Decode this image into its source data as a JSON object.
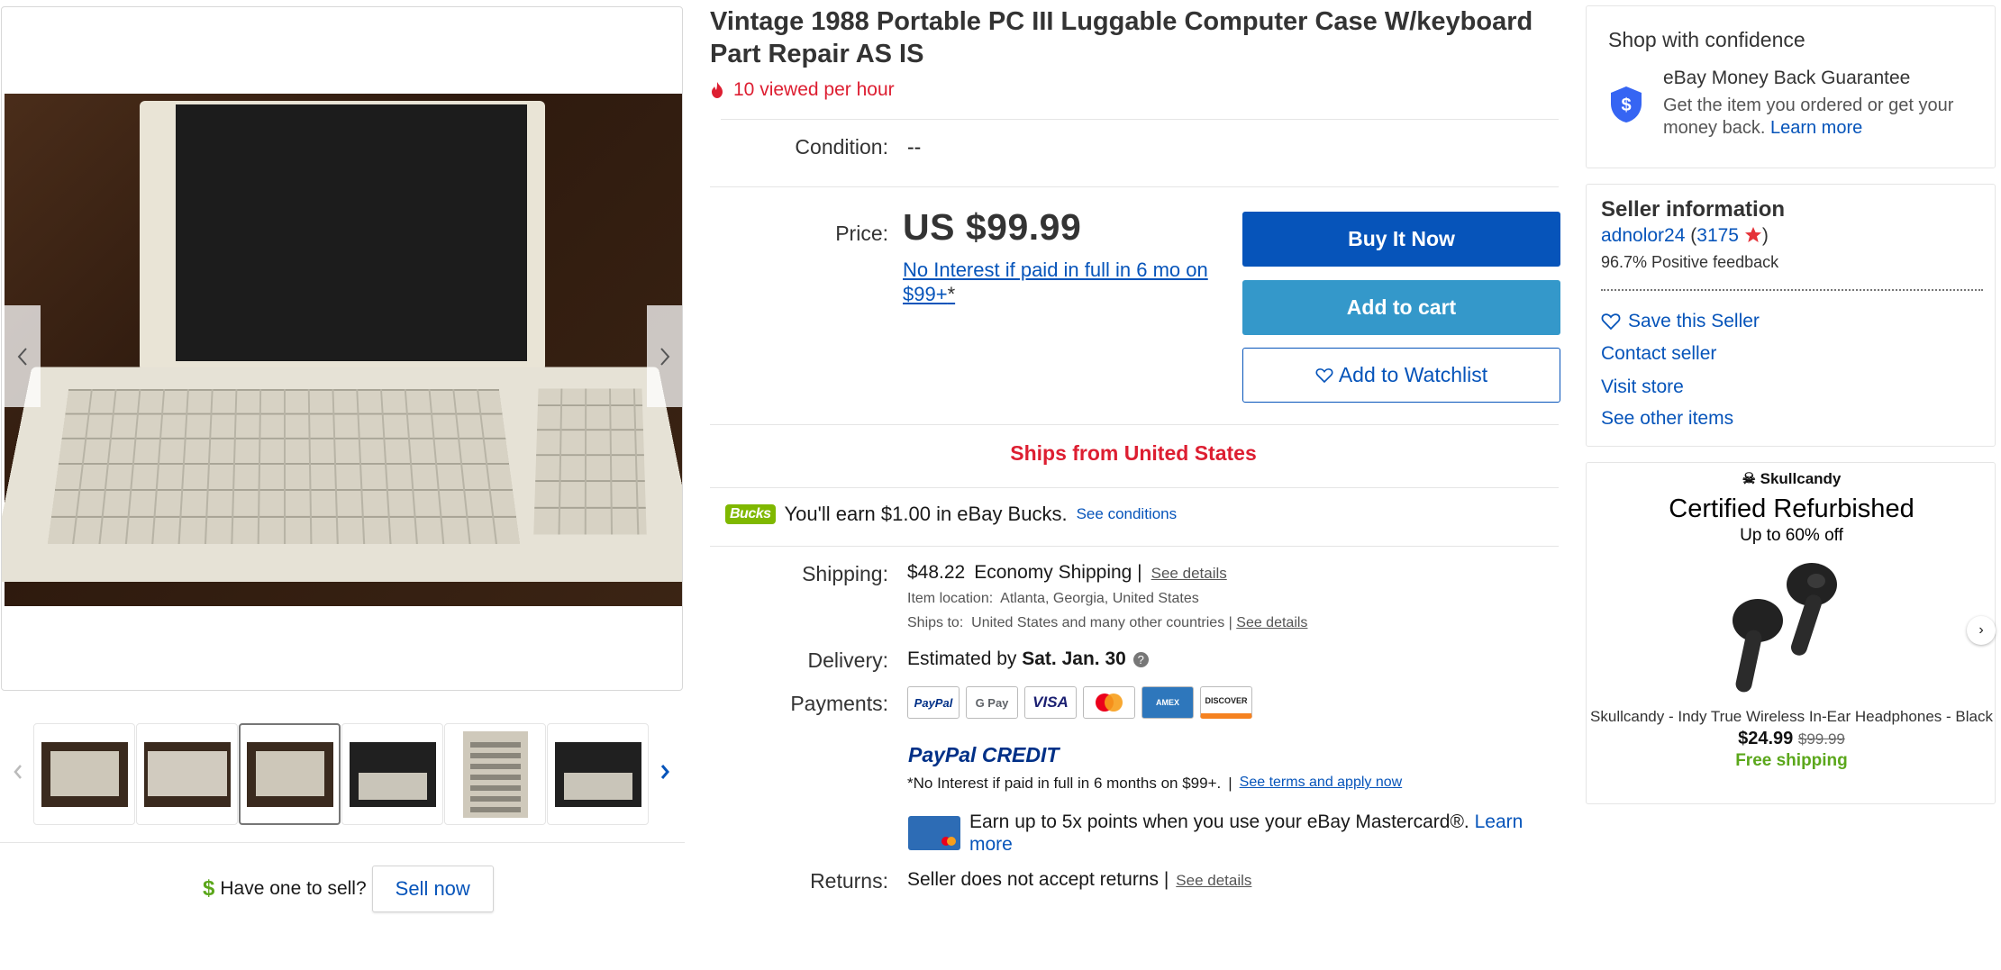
{
  "gallery": {
    "prev_icon": "chevron-left-icon",
    "next_icon": "chevron-right-icon",
    "thumb_prev_icon": "chevron-left-icon",
    "thumb_next_icon": "chevron-right-icon",
    "thumbnail_count": 6,
    "selected_thumbnail": 3
  },
  "sell": {
    "prompt": "Have one to sell?",
    "button": "Sell now",
    "icon": "dollar-icon"
  },
  "listing": {
    "title": "Vintage 1988 Portable PC III Luggable Computer Case W/keyboard Part Repair AS IS",
    "views": "10 viewed per hour",
    "condition_label": "Condition:",
    "condition_value": "--",
    "price_label": "Price:",
    "price": "US $99.99",
    "no_interest": "No Interest if paid in full in 6 mo on $99+",
    "no_interest_suffix": "*",
    "ships_from": "Ships from United States"
  },
  "actions": {
    "buy_now": "Buy It Now",
    "add_to_cart": "Add to cart",
    "add_to_watchlist": "Add to Watchlist"
  },
  "bucks": {
    "badge": "Bucks",
    "text_prefix": "You'll earn ",
    "amount": "$1.00",
    "text_suffix": " in eBay Bucks.",
    "link": "See conditions"
  },
  "shipping": {
    "label": "Shipping:",
    "cost": "$48.22",
    "method": "Economy Shipping |",
    "details_link": "See details",
    "location_label": "Item location:",
    "location": "Atlanta, Georgia, United States",
    "ships_to_label": "Ships to:",
    "ships_to": "United States and many other countries |",
    "ships_to_link": "See details"
  },
  "delivery": {
    "label": "Delivery:",
    "prefix": "Estimated by ",
    "date": "Sat. Jan. 30",
    "help_icon": "question-icon"
  },
  "payments": {
    "label": "Payments:",
    "logos": [
      "PayPal",
      "G Pay",
      "VISA",
      "MC",
      "AMEX",
      "DISCOVER"
    ],
    "paypal_credit": "PayPal CREDIT",
    "credit_note": "*No Interest if paid in full in 6 months on $99+.",
    "credit_sep": "|",
    "credit_link": "See terms and apply now",
    "mastercard_text": "Earn up to 5x points when you use your eBay Mastercard®.",
    "mastercard_link": "Learn more"
  },
  "returns": {
    "label": "Returns:",
    "text": "Seller does not accept returns |",
    "link": "See details"
  },
  "confidence": {
    "heading": "Shop with confidence",
    "guarantee_title": "eBay Money Back Guarantee",
    "guarantee_text": "Get the item you ordered or get your money back.",
    "learn_more": "Learn more"
  },
  "seller": {
    "heading": "Seller information",
    "name": "adnolor24",
    "feedback_score": "3175",
    "positive_feedback": "96.7% Positive feedback",
    "save_seller": "Save this Seller",
    "contact": "Contact seller",
    "visit_store": "Visit store",
    "other_items": "See other items"
  },
  "ad": {
    "brand": "Skullcandy",
    "title": "Certified Refurbished",
    "subtitle": "Up to 60% off",
    "product": "Skullcandy - Indy True Wireless In-Ear Headphones - Black",
    "price": "$24.99",
    "old_price": "$99.99",
    "shipping": "Free shipping"
  },
  "colors": {
    "accent_blue": "#0654ba",
    "cart_blue": "#3498ca",
    "alert_red": "#dd1e31",
    "free_green": "#5ba71b"
  }
}
